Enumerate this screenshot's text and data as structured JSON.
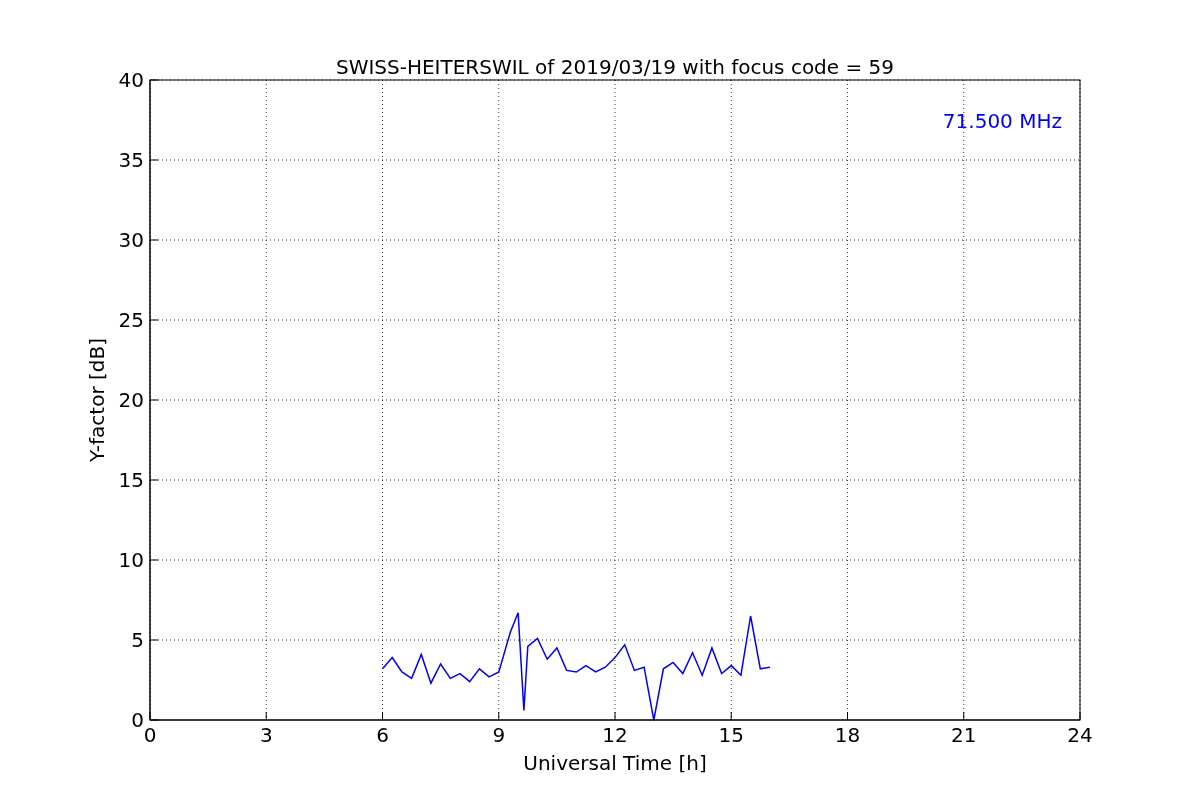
{
  "chart_data": {
    "type": "line",
    "title": "SWISS-HEITERSWIL of 2019/03/19 with focus code = 59",
    "xlabel": "Universal Time [h]",
    "ylabel": "Y-factor [dB]",
    "xlim": [
      0,
      24
    ],
    "ylim": [
      0,
      40
    ],
    "xticks": [
      0,
      3,
      6,
      9,
      12,
      15,
      18,
      21,
      24
    ],
    "yticks": [
      0,
      5,
      10,
      15,
      20,
      25,
      30,
      35,
      40
    ],
    "x": [
      6,
      6.25,
      6.5,
      6.75,
      7,
      7.25,
      7.5,
      7.75,
      8,
      8.25,
      8.5,
      8.75,
      9,
      9.3,
      9.5,
      9.65,
      9.75,
      10,
      10.25,
      10.5,
      10.75,
      11,
      11.25,
      11.5,
      11.75,
      12,
      12.25,
      12.5,
      12.75,
      13,
      13.25,
      13.5,
      13.75,
      14,
      14.25,
      14.5,
      14.75,
      15,
      15.25,
      15.5,
      15.75,
      16
    ],
    "grid": true,
    "series": [
      {
        "name": "71.500 MHz",
        "color": "#0000ff",
        "values": [
          3.2,
          3.9,
          3.0,
          2.6,
          4.1,
          2.3,
          3.5,
          2.6,
          2.9,
          2.4,
          3.2,
          2.7,
          3.0,
          5.5,
          6.7,
          0.6,
          4.6,
          5.1,
          3.8,
          4.5,
          3.1,
          3.0,
          3.4,
          3.0,
          3.3,
          3.9,
          4.7,
          3.1,
          3.3,
          0.0,
          3.2,
          3.6,
          2.9,
          4.2,
          2.8,
          4.5,
          2.9,
          3.4,
          2.8,
          6.5,
          3.2,
          3.3
        ]
      }
    ]
  }
}
